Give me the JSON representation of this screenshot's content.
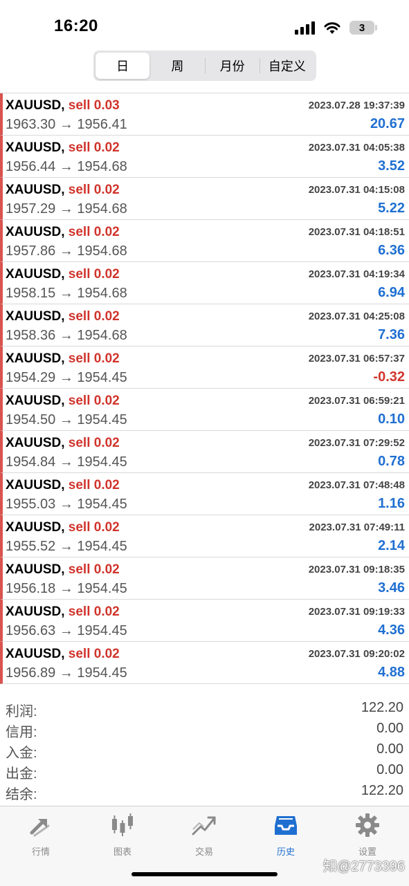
{
  "status": {
    "time": "16:20",
    "battery": "3"
  },
  "periods": [
    {
      "label": "日",
      "active": true
    },
    {
      "label": "周",
      "active": false
    },
    {
      "label": "月份",
      "active": false
    },
    {
      "label": "自定义",
      "active": false
    }
  ],
  "orders": [
    {
      "symbol": "XAUUSD,",
      "side": "sell 0.03",
      "time": "2023.07.28 19:37:39",
      "prices": "1963.30 → 1956.41",
      "profit": "20.67"
    },
    {
      "symbol": "XAUUSD,",
      "side": "sell 0.02",
      "time": "2023.07.31 04:05:38",
      "prices": "1956.44 → 1954.68",
      "profit": "3.52"
    },
    {
      "symbol": "XAUUSD,",
      "side": "sell 0.02",
      "time": "2023.07.31 04:15:08",
      "prices": "1957.29 → 1954.68",
      "profit": "5.22"
    },
    {
      "symbol": "XAUUSD,",
      "side": "sell 0.02",
      "time": "2023.07.31 04:18:51",
      "prices": "1957.86 → 1954.68",
      "profit": "6.36"
    },
    {
      "symbol": "XAUUSD,",
      "side": "sell 0.02",
      "time": "2023.07.31 04:19:34",
      "prices": "1958.15 → 1954.68",
      "profit": "6.94"
    },
    {
      "symbol": "XAUUSD,",
      "side": "sell 0.02",
      "time": "2023.07.31 04:25:08",
      "prices": "1958.36 → 1954.68",
      "profit": "7.36"
    },
    {
      "symbol": "XAUUSD,",
      "side": "sell 0.02",
      "time": "2023.07.31 06:57:37",
      "prices": "1954.29 → 1954.45",
      "profit": "-0.32"
    },
    {
      "symbol": "XAUUSD,",
      "side": "sell 0.02",
      "time": "2023.07.31 06:59:21",
      "prices": "1954.50 → 1954.45",
      "profit": "0.10"
    },
    {
      "symbol": "XAUUSD,",
      "side": "sell 0.02",
      "time": "2023.07.31 07:29:52",
      "prices": "1954.84 → 1954.45",
      "profit": "0.78"
    },
    {
      "symbol": "XAUUSD,",
      "side": "sell 0.02",
      "time": "2023.07.31 07:48:48",
      "prices": "1955.03 → 1954.45",
      "profit": "1.16"
    },
    {
      "symbol": "XAUUSD,",
      "side": "sell 0.02",
      "time": "2023.07.31 07:49:11",
      "prices": "1955.52 → 1954.45",
      "profit": "2.14"
    },
    {
      "symbol": "XAUUSD,",
      "side": "sell 0.02",
      "time": "2023.07.31 09:18:35",
      "prices": "1956.18 → 1954.45",
      "profit": "3.46"
    },
    {
      "symbol": "XAUUSD,",
      "side": "sell 0.02",
      "time": "2023.07.31 09:19:33",
      "prices": "1956.63 → 1954.45",
      "profit": "4.36"
    },
    {
      "symbol": "XAUUSD,",
      "side": "sell 0.02",
      "time": "2023.07.31 09:20:02",
      "prices": "1956.89 → 1954.45",
      "profit": "4.88"
    }
  ],
  "summary": [
    {
      "label": "利润:",
      "value": "122.20"
    },
    {
      "label": "信用:",
      "value": "0.00"
    },
    {
      "label": "入金:",
      "value": "0.00"
    },
    {
      "label": "出金:",
      "value": "0.00"
    },
    {
      "label": "结余:",
      "value": "122.20"
    }
  ],
  "tabs": [
    {
      "label": "行情",
      "icon": "quotes-arrows-icon",
      "active": false
    },
    {
      "label": "图表",
      "icon": "candlestick-chart-icon",
      "active": false
    },
    {
      "label": "交易",
      "icon": "trade-trend-icon",
      "active": false
    },
    {
      "label": "历史",
      "icon": "history-inbox-icon",
      "active": true
    },
    {
      "label": "设置",
      "icon": "gear-icon",
      "active": false
    }
  ],
  "watermark": "知@2773396",
  "colors": {
    "accent": "#1f6fd1",
    "sell": "#d0342c",
    "row_marker": "#d9534f"
  }
}
